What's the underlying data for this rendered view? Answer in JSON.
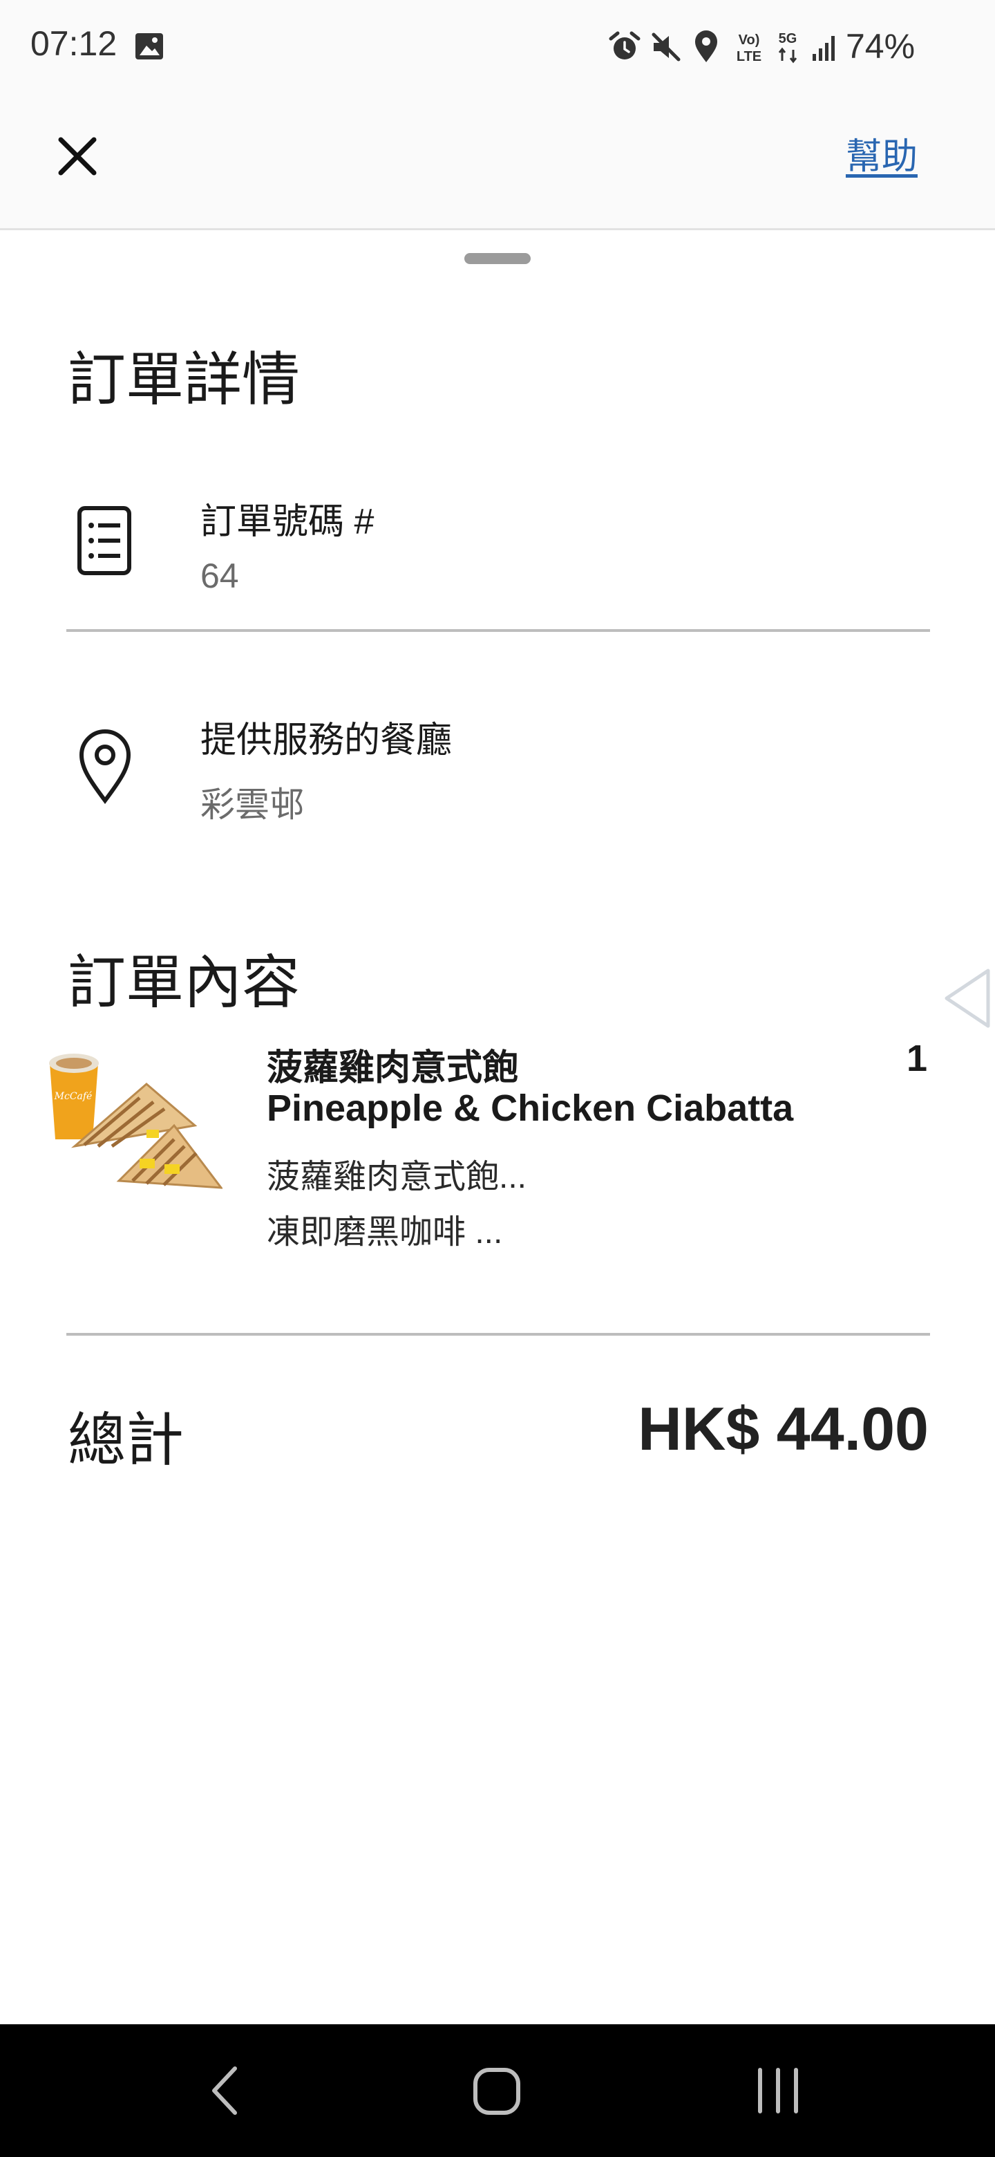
{
  "status_bar": {
    "time": "07:12",
    "battery": "74%",
    "icons": [
      "photo-icon",
      "alarm-icon",
      "mute-icon",
      "location-icon",
      "volte-icon",
      "5g-icon",
      "signal-icon"
    ]
  },
  "header": {
    "close_icon": "close-icon",
    "help_label": "幫助"
  },
  "order_details": {
    "title": "訂單詳情",
    "order_number_label": "訂單號碼 #",
    "order_number_value": "64",
    "restaurant_label": "提供服務的餐廳",
    "restaurant_value": "彩雲邨"
  },
  "order_contents": {
    "title": "訂單內容",
    "items": [
      {
        "name_zh": "菠蘿雞肉意式飽",
        "name_en": "Pineapple & Chicken Ciabatta",
        "quantity": "1",
        "sub_items": [
          "菠蘿雞肉意式飽...",
          "凍即磨黑咖啡 ..."
        ],
        "image": "mccafe-coffee-and-ciabatta"
      }
    ]
  },
  "total": {
    "label": "總計",
    "value": "HK$ 44.00"
  },
  "colors": {
    "link": "#2966b1",
    "text": "#1a1a1a",
    "secondary_text": "#6b6b6b",
    "divider": "#bdbdbd",
    "nav_bar": "#000000"
  }
}
